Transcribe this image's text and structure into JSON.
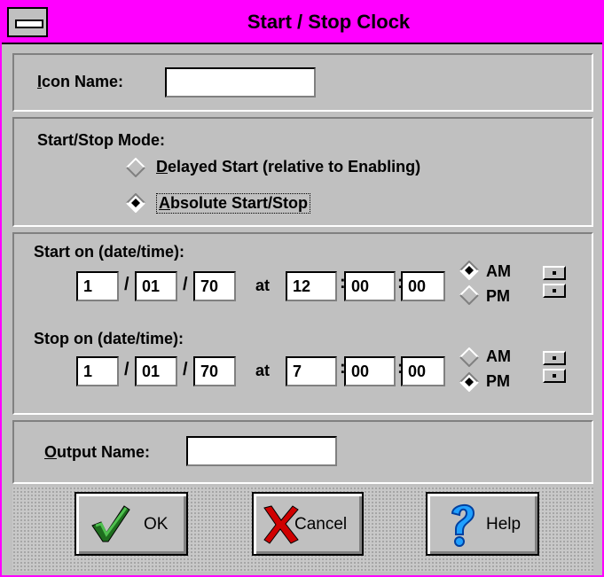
{
  "window": {
    "title": "Start / Stop Clock",
    "accent": "#ff00ff"
  },
  "icon_name": {
    "label": "Icon Name:",
    "value": ""
  },
  "mode": {
    "label": "Start/Stop Mode:",
    "options": [
      {
        "label": "Delayed Start (relative to Enabling)",
        "selected": false
      },
      {
        "label": "Absolute Start/Stop",
        "selected": true
      }
    ]
  },
  "start": {
    "label": "Start on (date/time):",
    "month": "1",
    "day": "01",
    "year": "70",
    "at_label": "at",
    "hour": "12",
    "minute": "00",
    "second": "00",
    "am_label": "AM",
    "pm_label": "PM",
    "meridiem": "AM"
  },
  "stop": {
    "label": "Stop on (date/time):",
    "month": "1",
    "day": "01",
    "year": "70",
    "at_label": "at",
    "hour": "7",
    "minute": "00",
    "second": "00",
    "am_label": "AM",
    "pm_label": "PM",
    "meridiem": "PM"
  },
  "output_name": {
    "label": "Output Name:",
    "value": ""
  },
  "buttons": {
    "ok": "OK",
    "cancel": "Cancel",
    "help": "Help"
  },
  "icons": {
    "ok": "checkmark-icon",
    "cancel": "red-x-icon",
    "help": "question-mark-icon"
  }
}
